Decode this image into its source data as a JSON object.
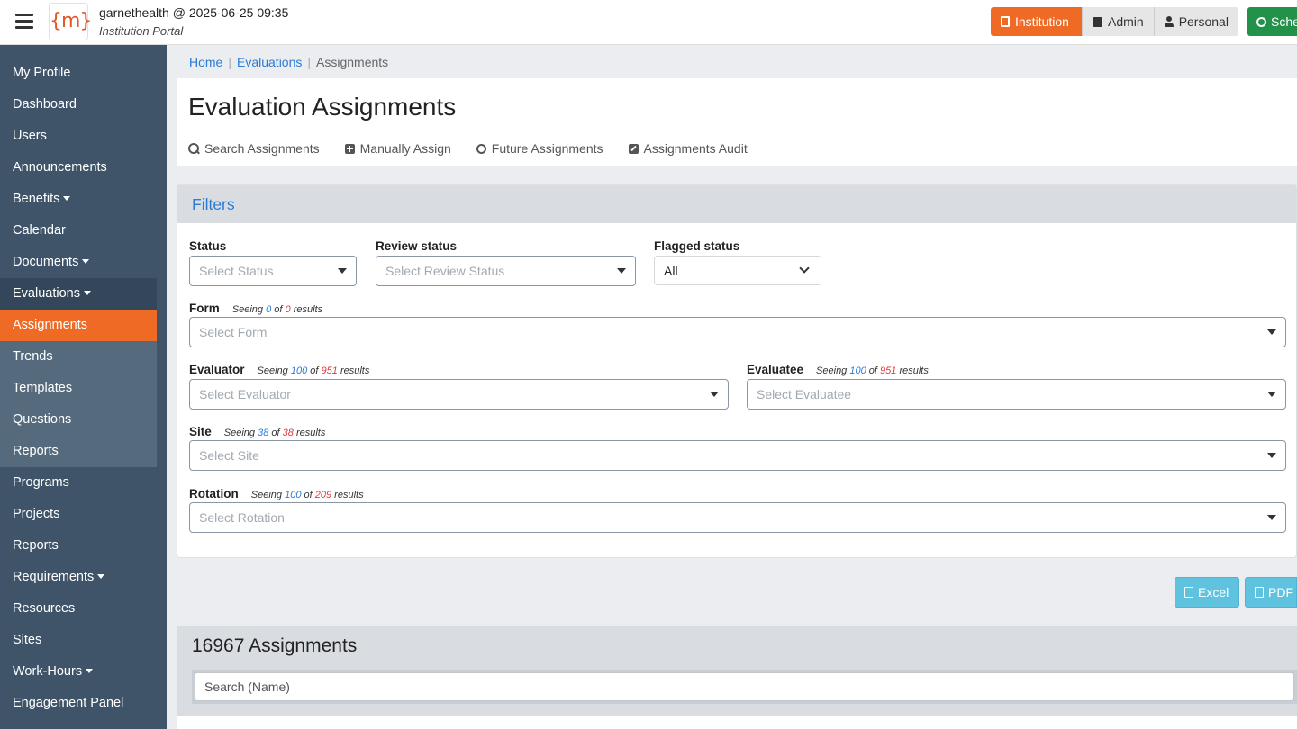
{
  "topbar": {
    "account": "garnethealth @ 2025-06-25 09:35",
    "portal": "Institution Portal",
    "logo_text": "{m}",
    "roles": [
      "Institution",
      "Admin",
      "Personal"
    ],
    "schedule_label": "Sche",
    "colors": {
      "institution": "#ef6b25",
      "schedule": "#23914a"
    }
  },
  "sidebar": {
    "items": [
      {
        "label": "My Profile"
      },
      {
        "label": "Dashboard"
      },
      {
        "label": "Users"
      },
      {
        "label": "Announcements"
      },
      {
        "label": "Benefits"
      },
      {
        "label": "Calendar"
      },
      {
        "label": "Documents"
      },
      {
        "label": "Evaluations"
      },
      {
        "label": "Assignments"
      },
      {
        "label": "Trends"
      },
      {
        "label": "Templates"
      },
      {
        "label": "Questions"
      },
      {
        "label": "Reports"
      },
      {
        "label": "Programs"
      },
      {
        "label": "Projects"
      },
      {
        "label": "Reports"
      },
      {
        "label": "Requirements"
      },
      {
        "label": "Resources"
      },
      {
        "label": "Sites"
      },
      {
        "label": "Work-Hours"
      },
      {
        "label": "Engagement Panel"
      }
    ]
  },
  "breadcrumb": {
    "home": "Home",
    "evaluations": "Evaluations",
    "current": "Assignments"
  },
  "page": {
    "title": "Evaluation Assignments",
    "tabs": [
      "Search Assignments",
      "Manually Assign",
      "Future Assignments",
      "Assignments Audit"
    ]
  },
  "filters": {
    "title": "Filters",
    "status": {
      "label": "Status",
      "placeholder": "Select Status"
    },
    "review_status": {
      "label": "Review status",
      "placeholder": "Select Review Status"
    },
    "flagged_status": {
      "label": "Flagged status",
      "value": "All"
    },
    "form": {
      "label": "Form",
      "seeing": "Seeing",
      "shown": "0",
      "of": "of",
      "total": "0",
      "results": "results",
      "placeholder": "Select Form"
    },
    "evaluator": {
      "label": "Evaluator",
      "seeing": "Seeing",
      "shown": "100",
      "of": "of",
      "total": "951",
      "results": "results",
      "placeholder": "Select Evaluator"
    },
    "evaluatee": {
      "label": "Evaluatee",
      "seeing": "Seeing",
      "shown": "100",
      "of": "of",
      "total": "951",
      "results": "results",
      "placeholder": "Select Evaluatee"
    },
    "site": {
      "label": "Site",
      "seeing": "Seeing",
      "shown": "38",
      "of": "of",
      "total": "38",
      "results": "results",
      "placeholder": "Select Site"
    },
    "rotation": {
      "label": "Rotation",
      "seeing": "Seeing",
      "shown": "100",
      "of": "of",
      "total": "209",
      "results": "results",
      "placeholder": "Select Rotation"
    }
  },
  "export": {
    "excel": "Excel",
    "pdf": "PDF"
  },
  "results": {
    "title": "16967 Assignments",
    "search_placeholder": "Search (Name)"
  }
}
